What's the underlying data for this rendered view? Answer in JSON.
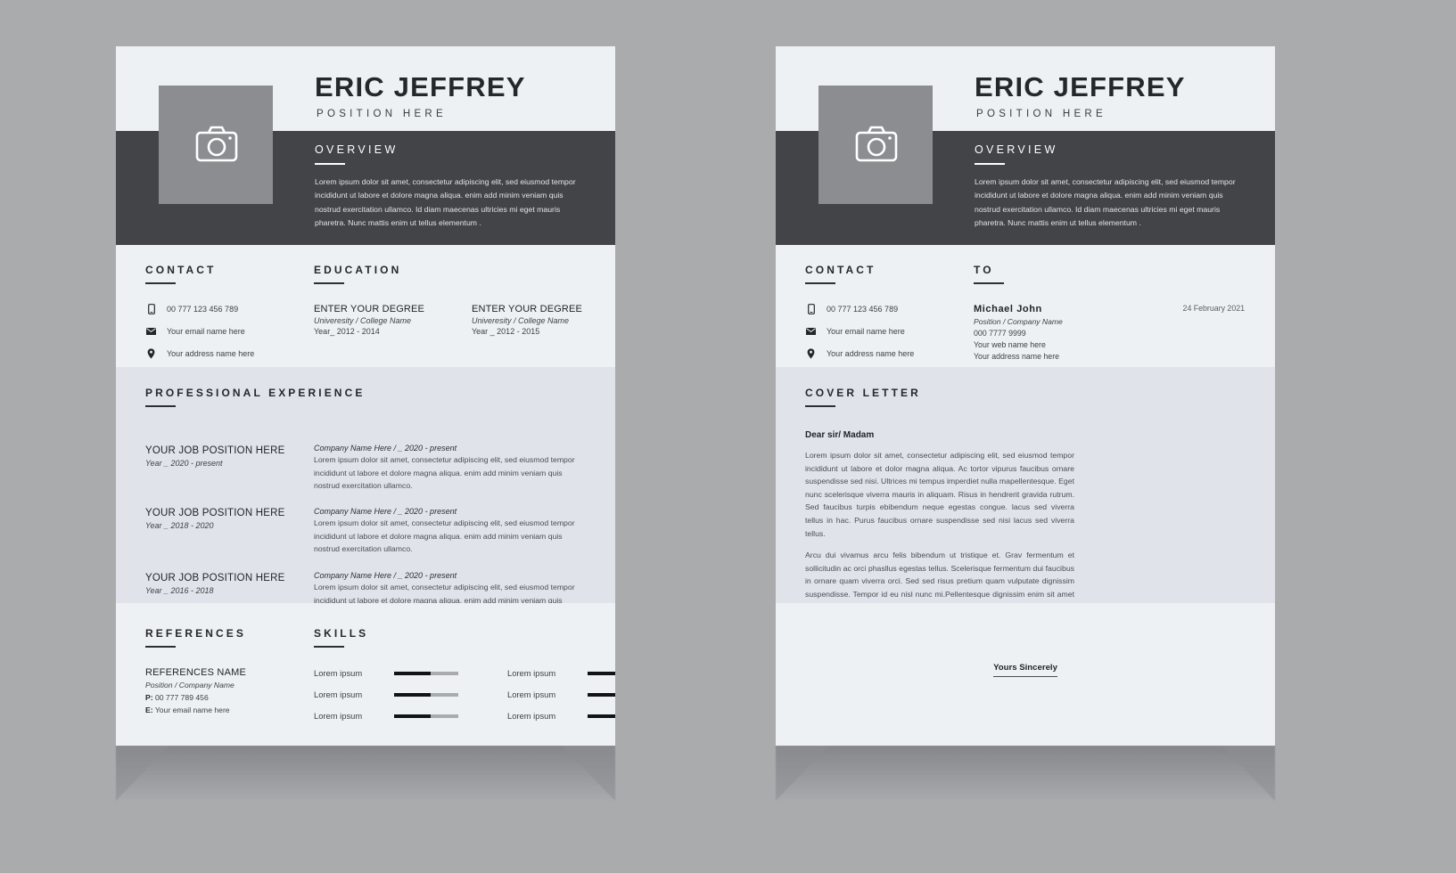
{
  "theme": {
    "background": "#aaabad",
    "page_light": "#eef1f3",
    "page_alt": "#e0e4ea",
    "dark_band": "#424448",
    "photo_fill": "#8b8d90",
    "text_dark": "#1f2226",
    "text_body": "#4a4d53",
    "bar_filled": "#111317",
    "bar_track": "#a9abaf"
  },
  "resume": {
    "header": {
      "name": "ERIC JEFFREY",
      "position": "POSITION HERE",
      "photo_icon": "camera-icon"
    },
    "overview": {
      "title": "OVERVIEW",
      "body": "Lorem ipsum dolor sit amet, consectetur adipiscing elit, sed eiusmod tempor incididunt ut labore et dolore magna aliqua. enim add minim veniam quis nostrud exercitation ullamco. Id diam maecenas ultricies mi eget mauris pharetra. Nunc mattis enim ut tellus elementum ."
    },
    "contact": {
      "title": "CONTACT",
      "items": [
        {
          "icon": "phone-icon",
          "value": "00 777 123 456 789"
        },
        {
          "icon": "envelope-icon",
          "value": "Your email name here"
        },
        {
          "icon": "location-pin-icon",
          "value": "Your address name here"
        }
      ]
    },
    "education": {
      "title": "EDUCATION",
      "entries": [
        {
          "degree": "ENTER YOUR DEGREE",
          "school": "Univeresity / College Name",
          "year": "Year_ 2012 - 2014"
        },
        {
          "degree": "ENTER YOUR DEGREE",
          "school": "Univeresity / College Name",
          "year": "Year _ 2012 - 2015"
        }
      ]
    },
    "experience": {
      "title": "PROFESSIONAL EXPERIENCE",
      "entries": [
        {
          "position": "YOUR JOB POSITION HERE",
          "year": "Year _ 2020 - present",
          "company": "Company Name Here / _ 2020 - present",
          "description": "Lorem ipsum dolor sit amet, consectetur adipiscing elit, sed eiusmod tempor incididunt ut labore et dolore magna aliqua. enim add minim veniam quis nostrud exercitation ullamco."
        },
        {
          "position": "YOUR JOB POSITION HERE",
          "year": "Year _ 2018 - 2020",
          "company": "Company Name Here / _ 2020 - present",
          "description": "Lorem ipsum dolor sit amet, consectetur adipiscing elit, sed eiusmod tempor incididunt ut labore et dolore magna aliqua. enim add minim veniam quis nostrud exercitation ullamco."
        },
        {
          "position": "YOUR JOB POSITION HERE",
          "year": "Year _ 2016 - 2018",
          "company": "Company Name Here / _ 2020 - present",
          "description": "Lorem ipsum dolor sit amet, consectetur adipiscing elit, sed eiusmod tempor incididunt ut labore et dolore magna aliqua. enim add minim veniam quis nostrud exercitation ullamco."
        }
      ]
    },
    "references": {
      "title": "REFERENCES",
      "name": "REFERENCES NAME",
      "position": "Position / Company Name",
      "phone_label": "P:",
      "phone": "00 777 789 456",
      "email_label": "E:",
      "email": "Your email name here"
    },
    "skills": {
      "title": "SKILLS",
      "column_left": [
        {
          "label": "Lorem ipsum",
          "level": 57
        },
        {
          "label": "Lorem ipsum",
          "level": 57
        },
        {
          "label": "Lorem ipsum",
          "level": 57
        }
      ],
      "column_right": [
        {
          "label": "Lorem ipsum",
          "level": 55
        },
        {
          "label": "Lorem ipsum",
          "level": 55
        },
        {
          "label": "Lorem ipsum",
          "level": 55
        }
      ]
    }
  },
  "cover": {
    "header": {
      "name": "ERIC JEFFREY",
      "position": "POSITION HERE",
      "photo_icon": "camera-icon"
    },
    "overview": {
      "title": "OVERVIEW",
      "body": "Lorem ipsum dolor sit amet, consectetur adipiscing elit, sed eiusmod tempor incididunt ut labore et dolore magna aliqua. enim add minim veniam quis nostrud exercitation ullamco. Id diam maecenas ultricies mi eget mauris pharetra. Nunc mattis enim ut tellus elementum ."
    },
    "contact": {
      "title": "CONTACT",
      "items": [
        {
          "icon": "phone-icon",
          "value": "00 777 123 456 789"
        },
        {
          "icon": "envelope-icon",
          "value": "Your email name here"
        },
        {
          "icon": "location-pin-icon",
          "value": "Your address name here"
        }
      ]
    },
    "to": {
      "title": "TO",
      "name": "Michael  John",
      "position": "Position / Company Name",
      "phone": "000 7777 9999",
      "web": "Your  web name here",
      "address": "Your address name here",
      "date": "24 February 2021"
    },
    "letter": {
      "title": "COVER LETTER",
      "greeting": "Dear sir/ Madam",
      "paragraph_1": "Lorem ipsum dolor sit amet, consectetur adipiscing elit, sed eiusmod tempor incididunt ut labore et dolor magna aliqua. Ac tortor vipurus faucibus ornare suspendisse sed nisi. Ultrices mi tempus imperdiet nulla mapellentesque. Eget nunc scelerisque viverra mauris in aliquam. Risus in hendrerit gravida rutrum. Sed faucibus turpis ebibendum neque egestas congue. lacus sed viverra tellus in hac. Purus faucibus ornare suspendisse sed nisi lacus sed viverra tellus.",
      "paragraph_2": "Arcu dui vivamus arcu felis bibendum ut tristique et. Grav fermentum et sollicitudin ac orci phasllus egestas tellus. Scelerisque fermentum dui faucibus in ornare quam viverra orci. Sed sed risus pretium quam vulputate dignissim suspendisse. Tempor id eu nisl nunc mi.Pellentesque dignissim enim sit amet venenatis urna. Purus faucibus ornare suspendisse sed nisi lacus sed. Sit amet aliquam id diam maecenas ultricies mi ellamcorper dignissim cras tincidunt lobortis feugiat vivamus  augue. Gravida arcu ac tortor dignissim. Mattis vulputate enim nulla aliquet porttitor lacus. Neque aliquam vestibulum.",
      "signoff": "Yours Sincerely"
    }
  }
}
